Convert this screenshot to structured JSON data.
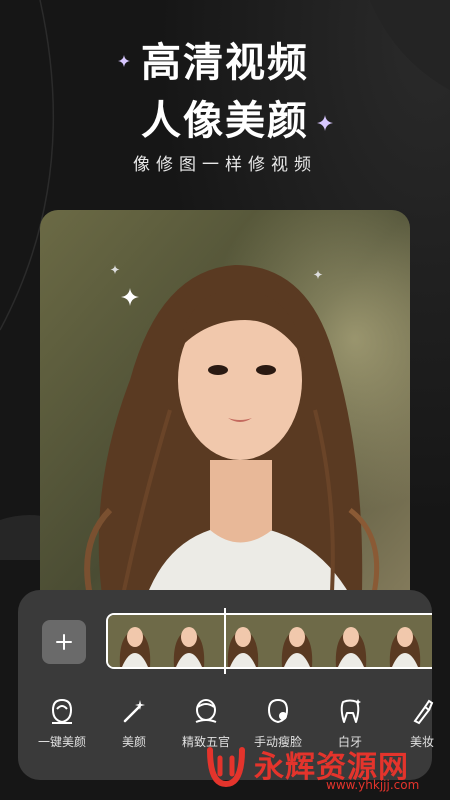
{
  "headline": {
    "line1": "高清视频",
    "line2": "人像美颜",
    "subtitle": "像修图一样修视频"
  },
  "colors": {
    "background": "#161616",
    "panel": "#3a3a3a",
    "watermark": "#e4342c"
  },
  "photo": {
    "description_icon": "portrait-photo"
  },
  "editor": {
    "add_icon": "plus-icon",
    "tools": [
      {
        "label": "一键美颜",
        "icon": "face-magic-icon"
      },
      {
        "label": "美颜",
        "icon": "magic-wand-icon"
      },
      {
        "label": "精致五官",
        "icon": "face-outline-icon"
      },
      {
        "label": "手动瘦脸",
        "icon": "face-slim-icon"
      },
      {
        "label": "白牙",
        "icon": "tooth-icon"
      },
      {
        "label": "美妆",
        "icon": "makeup-brush-icon"
      }
    ]
  },
  "watermark": {
    "title": "永辉资源网",
    "url": "www.yhkjjj.com"
  }
}
